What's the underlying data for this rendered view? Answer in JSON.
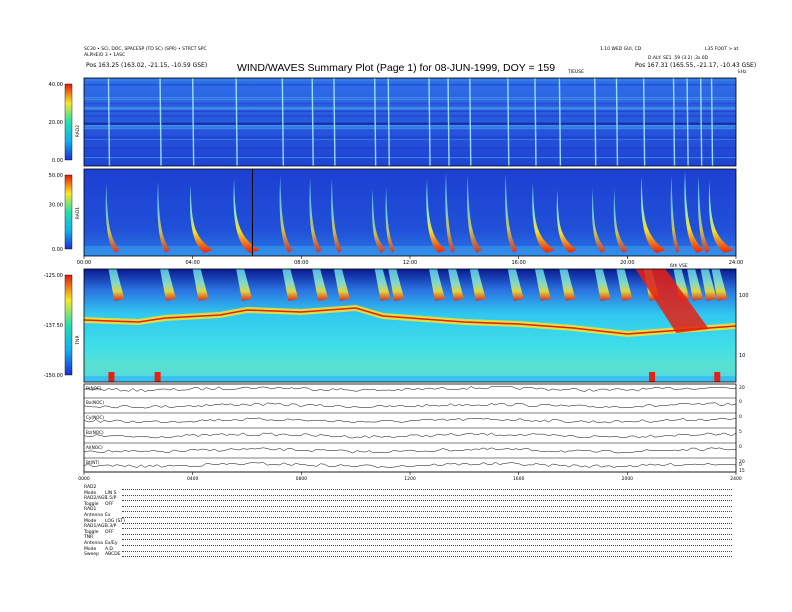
{
  "header": {
    "left_line1": "SC30 • SCI, DOC, SPACESP (TO SC) (SPR) • STRCT SPC",
    "left_line2": "ALPHEIO 3 • 1ASC",
    "right_line1": "1.10 WED GUI, CD",
    "right_line2": "L35 FOOT > at",
    "right_line3": "D.ALY: SE1 .59 (3.2) .3s.0D",
    "pos_left": "Pos    163.25 (163.02, -21.15, -10.59 GSE)",
    "pos_right": "Pos    167.31 (165.55, -21.17, -10.43 GSE)",
    "title": "WIND/WAVES Summary Plot (Page 1) for 08-JUN-1999, DOY = 159",
    "label_top_center": "TIEUSE",
    "label_top_right": "kHz",
    "label_mid_right": "6th VSE"
  },
  "chart_data": [
    {
      "type": "heatmap",
      "panel": "RAD2",
      "ylabel": "RAD2",
      "colorbar_ticks": [
        "40.00",
        "20.00",
        "0.00"
      ],
      "colorbar_range": [
        0,
        40
      ],
      "x_range_hours": [
        0,
        24
      ]
    },
    {
      "type": "heatmap",
      "panel": "RAD1",
      "ylabel": "RAD1",
      "colorbar_ticks": [
        "50.00",
        "30.00",
        "0.00"
      ],
      "colorbar_range": [
        0,
        50
      ],
      "x_ticks": [
        "00:00",
        "04:00",
        "08:00",
        "12:00",
        "16:00",
        "20:00",
        "24:00"
      ],
      "x_range_hours": [
        0,
        24
      ],
      "type_iii_bursts_hours": [
        0.9,
        2.8,
        4.0,
        5.6,
        7.3,
        8.4,
        9.2,
        10.7,
        11.2,
        12.7,
        13.4,
        14.2,
        15.6,
        16.6,
        17.5,
        18.8,
        19.6,
        20.6,
        21.7,
        22.2,
        22.7,
        23.1
      ]
    },
    {
      "type": "heatmap",
      "panel": "TNR",
      "ylabel": "TNR",
      "colorbar_ticks": [
        "-125.00",
        "-137.50",
        "-150.00"
      ],
      "colorbar_range": [
        -150,
        -125
      ],
      "right_ticks": [
        "100",
        "10"
      ],
      "x_range_hours": [
        0,
        24
      ]
    },
    {
      "type": "line",
      "panel": "magnetic field",
      "series": [
        {
          "name": "B(NOC)",
          "right_tick": "20"
        },
        {
          "name": "Bx(NOC)",
          "right_tick": "0"
        },
        {
          "name": "Cy(NOC)",
          "right_tick": "0"
        },
        {
          "name": "Bz(NOC)",
          "right_tick": "5"
        },
        {
          "name": "Al(NOC)",
          "right_tick": "0"
        },
        {
          "name": "Bt(NT)",
          "right_tick": "20"
        }
      ],
      "right_ticks_lower": [
        "0",
        "15"
      ],
      "x_ticks": [
        "0000",
        "0400",
        "0800",
        "1200",
        "1600",
        "2000",
        "2400"
      ],
      "x_range_hours": [
        0,
        24
      ]
    }
  ],
  "settings_block": [
    {
      "key": "RAD2",
      "value": ""
    },
    {
      "key": "Mode",
      "value": "LIN S"
    },
    {
      "key": "RAD2/AGF",
      "value": "1.5/P"
    },
    {
      "key": "Toggle",
      "value": "OFF"
    },
    {
      "key": "RAD1",
      "value": ""
    },
    {
      "key": "Antenna",
      "value": "Ex"
    },
    {
      "key": "Mode",
      "value": "LOG (ST)"
    },
    {
      "key": "RAD1/AGF",
      "value": "3.3/P"
    },
    {
      "key": "Toggle",
      "value": "OFF"
    },
    {
      "key": "TNR",
      "value": ""
    },
    {
      "key": "Antenna",
      "value": "Ex/Ey"
    },
    {
      "key": "Mode",
      "value": "A.D."
    },
    {
      "key": "Sweep",
      "value": "ABCDE"
    }
  ],
  "colors": {
    "cold": "#1c3fd0",
    "mid": "#3ab8e8",
    "warm": "#f2e02a",
    "hot": "#e82010"
  }
}
